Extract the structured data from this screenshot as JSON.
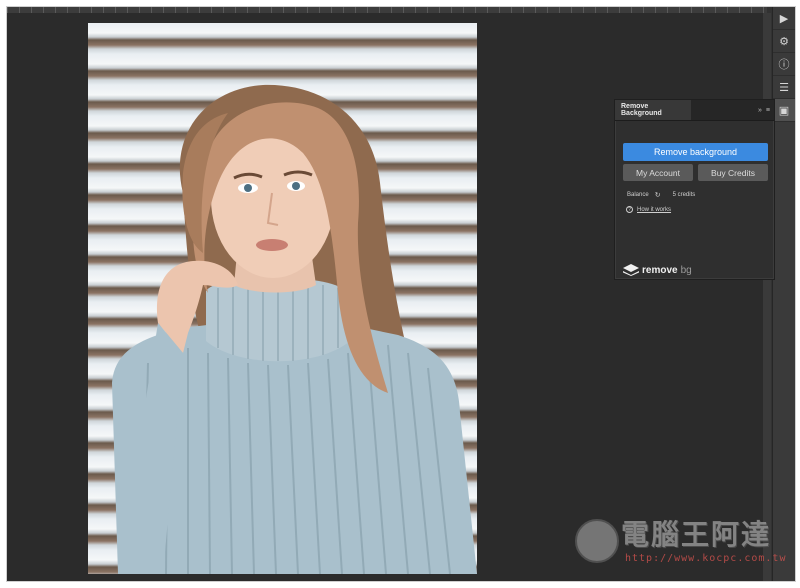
{
  "panel": {
    "tab_title": "Remove Background",
    "expand_glyph": "»",
    "menu_glyph": "≡",
    "remove_button": "Remove background",
    "my_account_button": "My Account",
    "buy_credits_button": "Buy Credits",
    "balance_label": "Balance",
    "refresh_glyph": "↻",
    "credits_text": "5 credits",
    "how_it_works": "How it works",
    "help_glyph": "?",
    "logo_word_1": "remove",
    "logo_word_2": "bg",
    "accent_color": "#3b8ae0"
  },
  "toolstrip": {
    "items": [
      {
        "icon": "play-icon",
        "glyph": "▶"
      },
      {
        "icon": "properties-icon",
        "glyph": "⚙"
      },
      {
        "icon": "info-icon",
        "glyph": "ⓘ"
      },
      {
        "icon": "adjustments-icon",
        "glyph": "☰"
      },
      {
        "icon": "plugin-icon",
        "glyph": "▣"
      }
    ]
  },
  "watermark": {
    "title": "電腦王阿達",
    "url": "http://www.kocpc.com.tw"
  }
}
